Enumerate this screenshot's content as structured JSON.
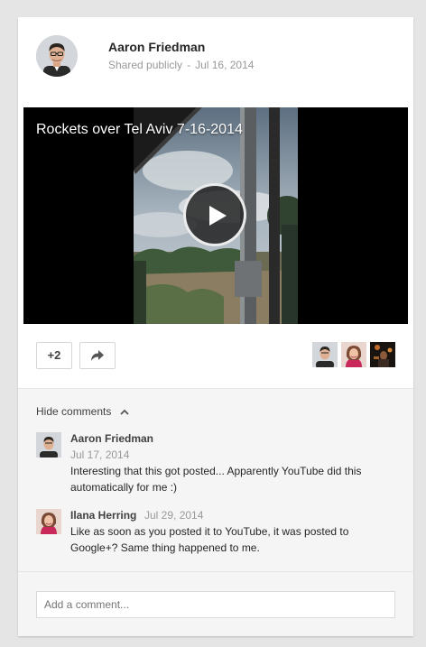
{
  "post": {
    "author": "Aaron Friedman",
    "visibility": "Shared publicly",
    "separator": "-",
    "date": "Jul 16, 2014"
  },
  "video": {
    "title": "Rockets over Tel Aviv 7-16-2014",
    "play_icon": "play-icon"
  },
  "actions": {
    "plus_label": "+2",
    "share_icon": "share-arrow-icon"
  },
  "comments": {
    "toggle_label": "Hide comments",
    "toggle_icon": "chevron-up-icon",
    "items": [
      {
        "author": "Aaron Friedman",
        "date": "Jul 17, 2014",
        "text": "Interesting that this got posted... Apparently YouTube did this automatically for me :)"
      },
      {
        "author": "Ilana Herring",
        "date": "Jul 29, 2014",
        "text": "Like as soon as you posted it to YouTube, it was posted to Google+? Same thing happened to me."
      }
    ],
    "input_placeholder": "Add a comment..."
  },
  "colors": {
    "background": "#e5e5e5",
    "card": "#ffffff",
    "comments_bg": "#f5f5f5",
    "muted_text": "#999999"
  }
}
